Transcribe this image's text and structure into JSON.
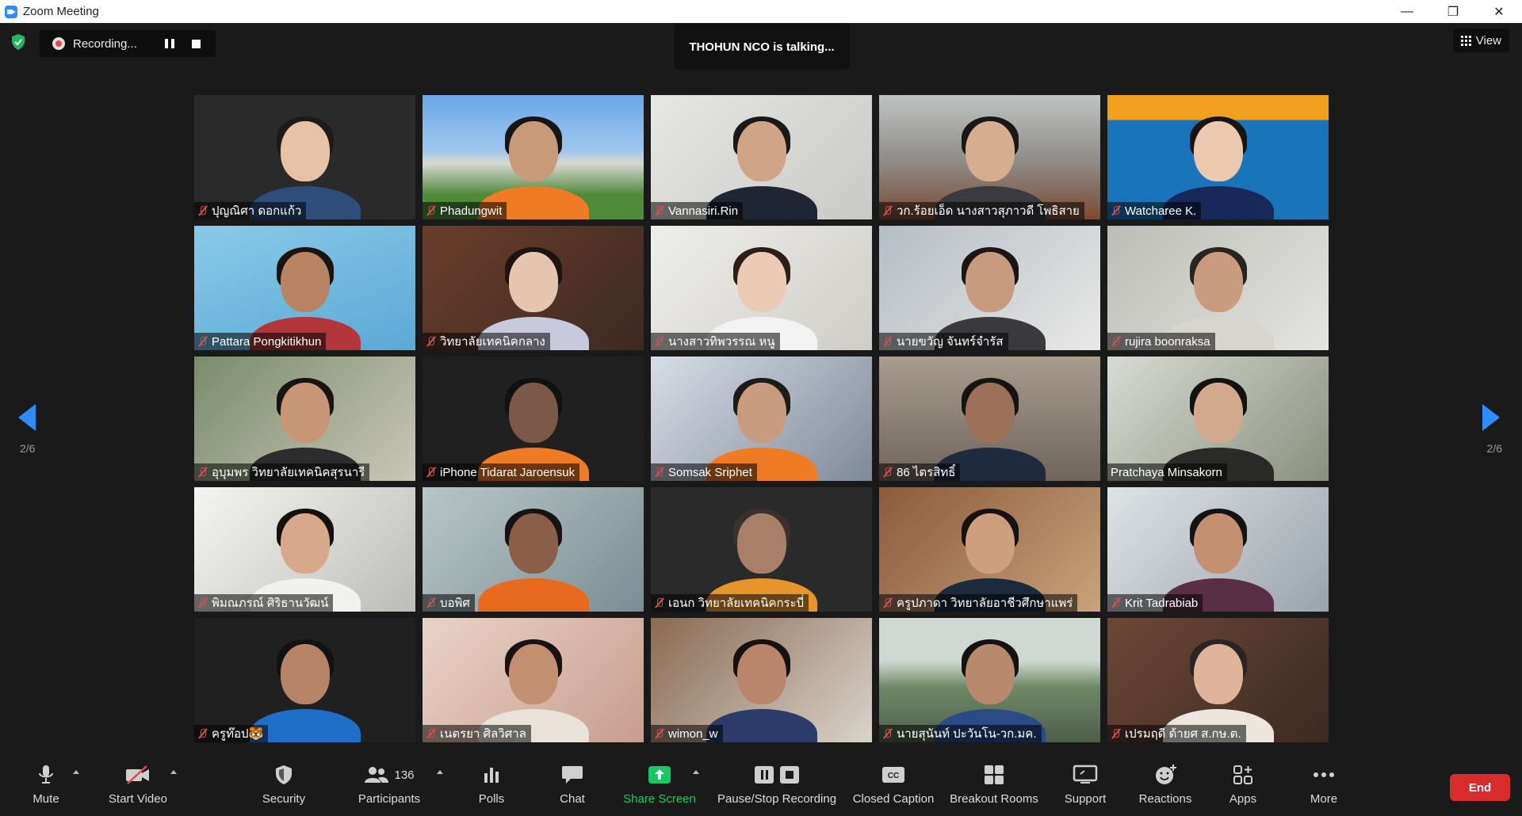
{
  "window": {
    "title": "Zoom Meeting",
    "minimize": "—",
    "restore": "❐",
    "close": "✕"
  },
  "recording": {
    "label": "Recording..."
  },
  "speaker": {
    "text": "THOHUN NCO is talking..."
  },
  "view": {
    "label": "View"
  },
  "pagination": {
    "left": "2/6",
    "right": "2/6"
  },
  "participants": [
    {
      "name": "ปุญณิศา ดอกแก้ว",
      "muted": true
    },
    {
      "name": "Phadungwit",
      "muted": true
    },
    {
      "name": "Vannasiri.Rin",
      "muted": true
    },
    {
      "name": "วก.ร้อยเอ็ด นางสาวสุภาวดี โพธิสาย",
      "muted": true
    },
    {
      "name": "Watcharee K.",
      "muted": true
    },
    {
      "name": "Pattara Pongkitikhun",
      "muted": true
    },
    {
      "name": "วิทยาลัยเทคนิคกลาง",
      "muted": true
    },
    {
      "name": "นางสาวทิพวรรณ หนู",
      "muted": true
    },
    {
      "name": "นายขวัญ จันทร์จำรัส",
      "muted": true
    },
    {
      "name": "rujira boonraksa",
      "muted": true
    },
    {
      "name": "อุบุมพร วิทยาลัยเทคนิคสุรนารี",
      "muted": true
    },
    {
      "name": "iPhone Tidarat Jaroensuk",
      "muted": true
    },
    {
      "name": "Somsak Sriphet",
      "muted": true
    },
    {
      "name": "86 ไตรสิทธิ์",
      "muted": true
    },
    {
      "name": "Pratchaya Minsakorn",
      "muted": false
    },
    {
      "name": "พิมณภรณ์ ศิริธานวัฒน์",
      "muted": true
    },
    {
      "name": "บอพิศ",
      "muted": true
    },
    {
      "name": "เอนก วิทยาลัยเทคนิคกระบี่",
      "muted": true
    },
    {
      "name": "ครูปภาดา วิทยาลัยอาชีวศึกษาแพร่",
      "muted": true
    },
    {
      "name": "Krit Tadrabiab",
      "muted": true
    },
    {
      "name": "ครูท๊อป🐯",
      "muted": true
    },
    {
      "name": "เนตรยา ศิลวิศาล",
      "muted": true
    },
    {
      "name": "wimon_w",
      "muted": true
    },
    {
      "name": "นายสุนันท์ ปะวันโน-วก.มค.",
      "muted": true
    },
    {
      "name": "เปรมฤดี ด้ายศ ส.กษ.ต.",
      "muted": true
    }
  ],
  "toolbar": {
    "mute": "Mute",
    "start_video": "Start Video",
    "security": "Security",
    "participants": "Participants",
    "participants_count": "136",
    "polls": "Polls",
    "chat": "Chat",
    "share_screen": "Share Screen",
    "pause_stop_recording": "Pause/Stop Recording",
    "closed_caption": "Closed Caption",
    "breakout_rooms": "Breakout Rooms",
    "support": "Support",
    "reactions": "Reactions",
    "apps": "Apps",
    "more": "More",
    "end": "End"
  },
  "colors": {
    "accent": "#2d8cff",
    "share_green": "#17c964",
    "end_red": "#d92d2d",
    "muted_red": "#e5484d"
  }
}
